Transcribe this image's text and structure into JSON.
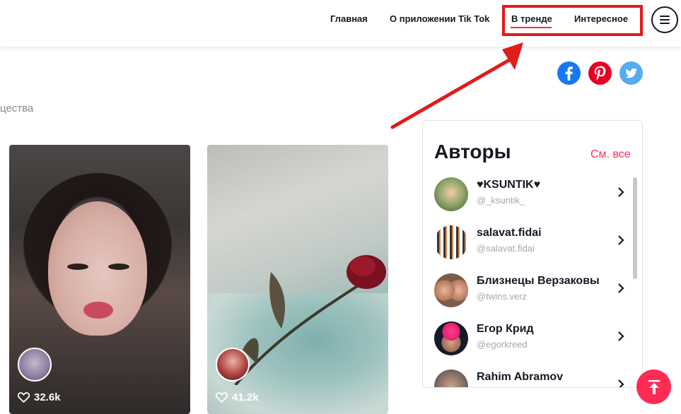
{
  "nav": {
    "items": [
      {
        "label": "Главная"
      },
      {
        "label": "О приложении Tik Tok"
      },
      {
        "label": "В тренде",
        "active": true
      },
      {
        "label": "Интересное"
      }
    ],
    "menu_icon": "hamburger-icon"
  },
  "social": [
    {
      "icon": "facebook-icon",
      "color": "#1877f2"
    },
    {
      "icon": "pinterest-icon",
      "color": "#e60023"
    },
    {
      "icon": "twitter-icon",
      "color": "#55acee"
    }
  ],
  "cut_text": "цества",
  "videos": [
    {
      "likes": "32.6k"
    },
    {
      "likes": "41.2k"
    }
  ],
  "authors": {
    "title": "Авторы",
    "see_all": "См. все",
    "items": [
      {
        "name": "♥KSUNTIK♥",
        "handle": "@_ksuntik_"
      },
      {
        "name": "salavat.fidai",
        "handle": "@salavat.fidai"
      },
      {
        "name": "Близнецы Верзаковы",
        "handle": "@twins.verz"
      },
      {
        "name": "Егор Крид",
        "handle": "@egorkreed"
      },
      {
        "name": "Rahim Abramov",
        "handle": ""
      }
    ]
  },
  "colors": {
    "accent": "#fe2c55",
    "annotation_red": "#e21b1b",
    "text": "#161823",
    "muted": "#a7a8ac"
  }
}
